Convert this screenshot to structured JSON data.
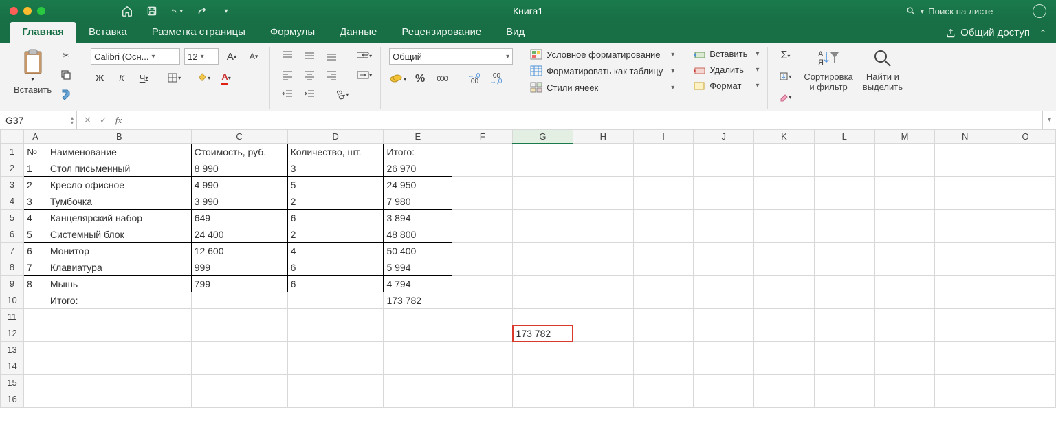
{
  "title": "Книга1",
  "search_placeholder": "Поиск на листе",
  "tabs": {
    "home": "Главная",
    "insert": "Вставка",
    "layout": "Разметка страницы",
    "formulas": "Формулы",
    "data": "Данные",
    "review": "Рецензирование",
    "view": "Вид",
    "share": "Общий доступ"
  },
  "ribbon": {
    "paste": "Вставить",
    "font_name": "Calibri (Осн...",
    "font_size": "12",
    "bold": "Ж",
    "italic": "К",
    "underline": "Ч",
    "number_format": "Общий",
    "cond_fmt": "Условное форматирование",
    "fmt_table": "Форматировать как таблицу",
    "cell_styles": "Стили ячеек",
    "insert_cells": "Вставить",
    "delete_cells": "Удалить",
    "format_cells": "Формат",
    "sort_filter": "Сортировка\nи фильтр",
    "find_select": "Найти и\nвыделить"
  },
  "namebox": "G37",
  "fx": "fx",
  "columns": [
    "A",
    "B",
    "C",
    "D",
    "E",
    "F",
    "G",
    "H",
    "I",
    "J",
    "K",
    "L",
    "M",
    "N",
    "O"
  ],
  "headers": {
    "num": "№",
    "name": "Наименование",
    "cost": "Стоимость, руб.",
    "qty": "Количество, шт.",
    "total": "Итого:"
  },
  "rows": [
    {
      "n": "1",
      "name": "Стол письменный",
      "cost": "8 990",
      "qty": "3",
      "total": "26 970"
    },
    {
      "n": "2",
      "name": "Кресло офисное",
      "cost": "4 990",
      "qty": "5",
      "total": "24 950"
    },
    {
      "n": "3",
      "name": "Тумбочка",
      "cost": "3 990",
      "qty": "2",
      "total": "7 980"
    },
    {
      "n": "4",
      "name": "Канцелярский набор",
      "cost": "649",
      "qty": "6",
      "total": "3 894"
    },
    {
      "n": "5",
      "name": "Системный блок",
      "cost": "24 400",
      "qty": "2",
      "total": "48 800"
    },
    {
      "n": "6",
      "name": "Монитор",
      "cost": "12 600",
      "qty": "4",
      "total": "50 400"
    },
    {
      "n": "7",
      "name": "Клавиатура",
      "cost": "999",
      "qty": "6",
      "total": "5 994"
    },
    {
      "n": "8",
      "name": "Мышь",
      "cost": "799",
      "qty": "6",
      "total": "4 794"
    }
  ],
  "footer": {
    "label": "Итого:",
    "total": "173 782"
  },
  "g12": "173 782",
  "percent": "%",
  "thousand": "000"
}
